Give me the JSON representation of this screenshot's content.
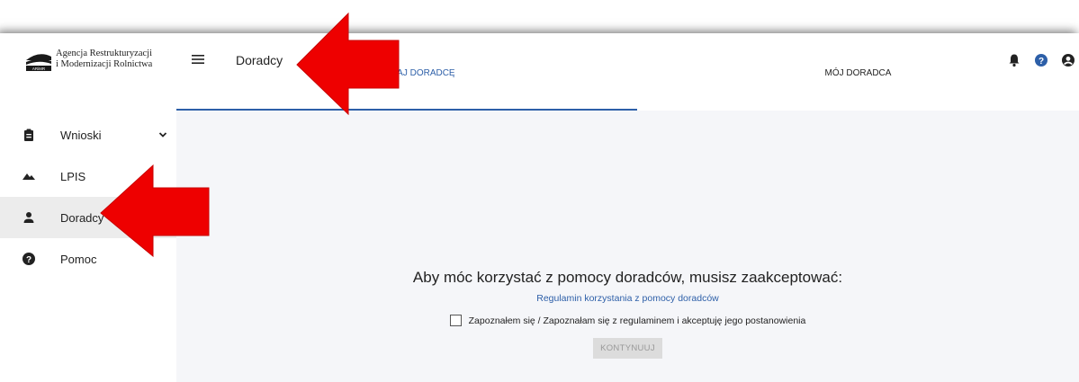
{
  "logo": {
    "line1": "Agencja Restrukturyzacji",
    "line2": "i Modernizacji Rolnictwa",
    "mark_text": "ARiMR"
  },
  "sidebar": {
    "items": [
      {
        "label": "Wnioski",
        "icon": "clipboard-icon",
        "expandable": true,
        "active": false
      },
      {
        "label": "LPIS",
        "icon": "terrain-icon",
        "expandable": false,
        "active": false
      },
      {
        "label": "Doradcy",
        "icon": "person-icon",
        "expandable": false,
        "active": true
      },
      {
        "label": "Pomoc",
        "icon": "help-icon",
        "expandable": false,
        "active": false
      }
    ]
  },
  "header": {
    "title": "Doradcy",
    "icons": [
      "bell-icon",
      "help-circle-icon",
      "account-icon"
    ]
  },
  "tabs": [
    {
      "label": "WYSZUKAJ DORADCĘ",
      "active": true
    },
    {
      "label": "MÓJ DORADCA",
      "active": false
    }
  ],
  "consent": {
    "title": "Aby móc korzystać z pomocy doradców, musisz zaakceptować:",
    "link": "Regulamin korzystania z pomocy doradców",
    "checkbox_label": "Zapoznałem się / Zapoznałam się z regulaminem i akceptuję jego postanowienia",
    "checkbox_checked": false,
    "button": "KONTYNUUJ"
  },
  "colors": {
    "accent": "#2d5fa8",
    "arrow": "#ee0000",
    "active_bg": "#ececec",
    "content_bg": "#f5f6f9"
  }
}
